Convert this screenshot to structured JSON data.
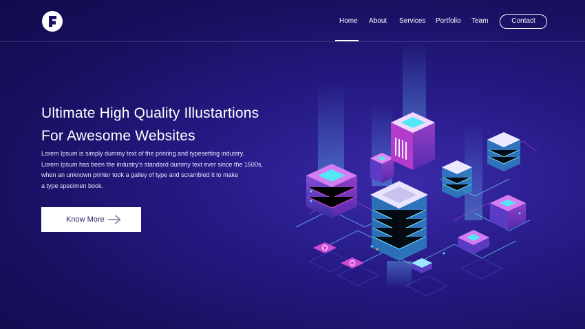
{
  "header": {
    "logo_icon": "brand-f-logo-icon",
    "nav": [
      "Home",
      "About",
      "Services",
      "Portfolio",
      "Team"
    ],
    "active_nav": "Home",
    "contact_label": "Contact"
  },
  "hero": {
    "title_line1": "Ultimate High Quality Illustartions",
    "title_line2": "For Awesome Websites",
    "text_lines": [
      "Lorem Ipsum is simply dummy text of the printing and typesetting industry.",
      "Lorem Ipsum has been the industry's standard dummy text ever since the 1500s,",
      "when an unknown printer took a galley of type and scrambled it to make",
      "a type specimen book."
    ],
    "cta_label": "Know More",
    "cta_icon": "arrow-right-icon"
  },
  "illustration": {
    "icon": "isometric-server-network-illustration",
    "colors": {
      "cyan": "#55e6f5",
      "magenta": "#d04bd6",
      "violet": "#6a56e8",
      "white": "#f2f0ff"
    }
  }
}
